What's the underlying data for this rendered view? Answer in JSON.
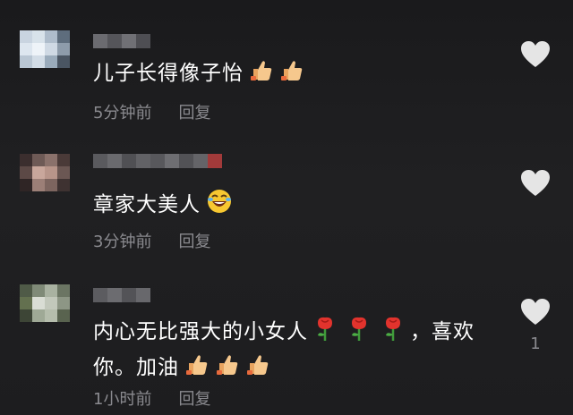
{
  "comments": [
    {
      "text_lines": [
        "儿子长得像子怡"
      ],
      "emojis": [
        "thumbs-up-icon",
        "thumbs-up-icon"
      ],
      "time": "5分钟前",
      "reply": "回复",
      "likes": ""
    },
    {
      "text_lines": [
        "章家大美人"
      ],
      "emojis": [
        "laughing-face-icon"
      ],
      "time": "3分钟前",
      "reply": "回复",
      "likes": ""
    },
    {
      "text_lines": [
        "内心无比强大的小女人",
        "，喜欢",
        "你。加油"
      ],
      "emojis": [
        "rose-icon",
        "rose-icon",
        "rose-icon",
        "thumbs-up-icon",
        "thumbs-up-icon",
        "thumbs-up-icon"
      ],
      "time": "1小时前",
      "reply": "回复",
      "likes": "1"
    }
  ],
  "colors": {
    "background": "#1b1b1d",
    "text": "#ffffff",
    "meta": "#8a8a8f",
    "heart": "#e5e5e5"
  }
}
